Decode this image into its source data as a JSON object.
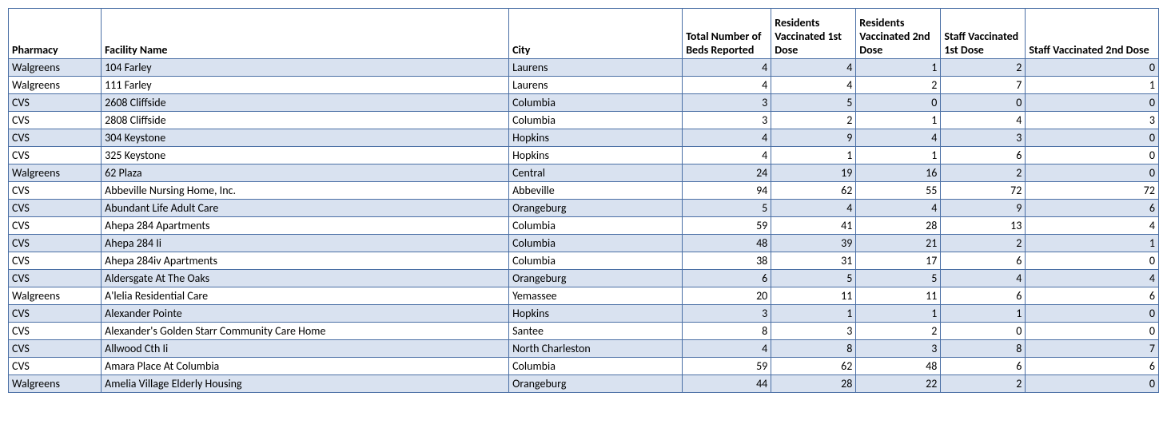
{
  "headers": {
    "pharmacy": "Pharmacy",
    "facility": "Facility Name",
    "city": "City",
    "beds": "Total Number of Beds Reported",
    "res1": "Residents Vaccinated 1st Dose",
    "res2": "Residents Vaccinated 2nd Dose",
    "staff1": "Staff Vaccinated 1st Dose",
    "staff2": "Staff Vaccinated 2nd Dose"
  },
  "rows": [
    {
      "pharmacy": "Walgreens",
      "facility": "104 Farley",
      "city": "Laurens",
      "beds": 4,
      "res1": 4,
      "res2": 1,
      "staff1": 2,
      "staff2": 0
    },
    {
      "pharmacy": "Walgreens",
      "facility": "111 Farley",
      "city": "Laurens",
      "beds": 4,
      "res1": 4,
      "res2": 2,
      "staff1": 7,
      "staff2": 1
    },
    {
      "pharmacy": "CVS",
      "facility": "2608 Cliffside",
      "city": "Columbia",
      "beds": 3,
      "res1": 5,
      "res2": 0,
      "staff1": 0,
      "staff2": 0
    },
    {
      "pharmacy": "CVS",
      "facility": "2808 Cliffside",
      "city": "Columbia",
      "beds": 3,
      "res1": 2,
      "res2": 1,
      "staff1": 4,
      "staff2": 3
    },
    {
      "pharmacy": "CVS",
      "facility": "304 Keystone",
      "city": "Hopkins",
      "beds": 4,
      "res1": 9,
      "res2": 4,
      "staff1": 3,
      "staff2": 0
    },
    {
      "pharmacy": "CVS",
      "facility": "325 Keystone",
      "city": "Hopkins",
      "beds": 4,
      "res1": 1,
      "res2": 1,
      "staff1": 6,
      "staff2": 0
    },
    {
      "pharmacy": "Walgreens",
      "facility": "62 Plaza",
      "city": "Central",
      "beds": 24,
      "res1": 19,
      "res2": 16,
      "staff1": 2,
      "staff2": 0
    },
    {
      "pharmacy": "CVS",
      "facility": "Abbeville Nursing Home, Inc.",
      "city": "Abbeville",
      "beds": 94,
      "res1": 62,
      "res2": 55,
      "staff1": 72,
      "staff2": 72
    },
    {
      "pharmacy": "CVS",
      "facility": "Abundant Life Adult Care",
      "city": "Orangeburg",
      "beds": 5,
      "res1": 4,
      "res2": 4,
      "staff1": 9,
      "staff2": 6
    },
    {
      "pharmacy": "CVS",
      "facility": "Ahepa 284 Apartments",
      "city": "Columbia",
      "beds": 59,
      "res1": 41,
      "res2": 28,
      "staff1": 13,
      "staff2": 4
    },
    {
      "pharmacy": "CVS",
      "facility": "Ahepa 284 Ii",
      "city": "Columbia",
      "beds": 48,
      "res1": 39,
      "res2": 21,
      "staff1": 2,
      "staff2": 1
    },
    {
      "pharmacy": "CVS",
      "facility": "Ahepa 284iv Apartments",
      "city": "Columbia",
      "beds": 38,
      "res1": 31,
      "res2": 17,
      "staff1": 6,
      "staff2": 0
    },
    {
      "pharmacy": "CVS",
      "facility": "Aldersgate At The Oaks",
      "city": "Orangeburg",
      "beds": 6,
      "res1": 5,
      "res2": 5,
      "staff1": 4,
      "staff2": 4
    },
    {
      "pharmacy": "Walgreens",
      "facility": "A'lelia Residential Care",
      "city": "Yemassee",
      "beds": 20,
      "res1": 11,
      "res2": 11,
      "staff1": 6,
      "staff2": 6
    },
    {
      "pharmacy": "CVS",
      "facility": "Alexander Pointe",
      "city": "Hopkins",
      "beds": 3,
      "res1": 1,
      "res2": 1,
      "staff1": 1,
      "staff2": 0
    },
    {
      "pharmacy": "CVS",
      "facility": "Alexander's Golden Starr Community Care Home",
      "city": "Santee",
      "beds": 8,
      "res1": 3,
      "res2": 2,
      "staff1": 0,
      "staff2": 0
    },
    {
      "pharmacy": "CVS",
      "facility": "Allwood Cth Ii",
      "city": "North Charleston",
      "beds": 4,
      "res1": 8,
      "res2": 3,
      "staff1": 8,
      "staff2": 7
    },
    {
      "pharmacy": "CVS",
      "facility": "Amara Place At Columbia",
      "city": "Columbia",
      "beds": 59,
      "res1": 62,
      "res2": 48,
      "staff1": 6,
      "staff2": 6
    },
    {
      "pharmacy": "Walgreens",
      "facility": "Amelia Village Elderly Housing",
      "city": "Orangeburg",
      "beds": 44,
      "res1": 28,
      "res2": 22,
      "staff1": 2,
      "staff2": 0
    }
  ]
}
